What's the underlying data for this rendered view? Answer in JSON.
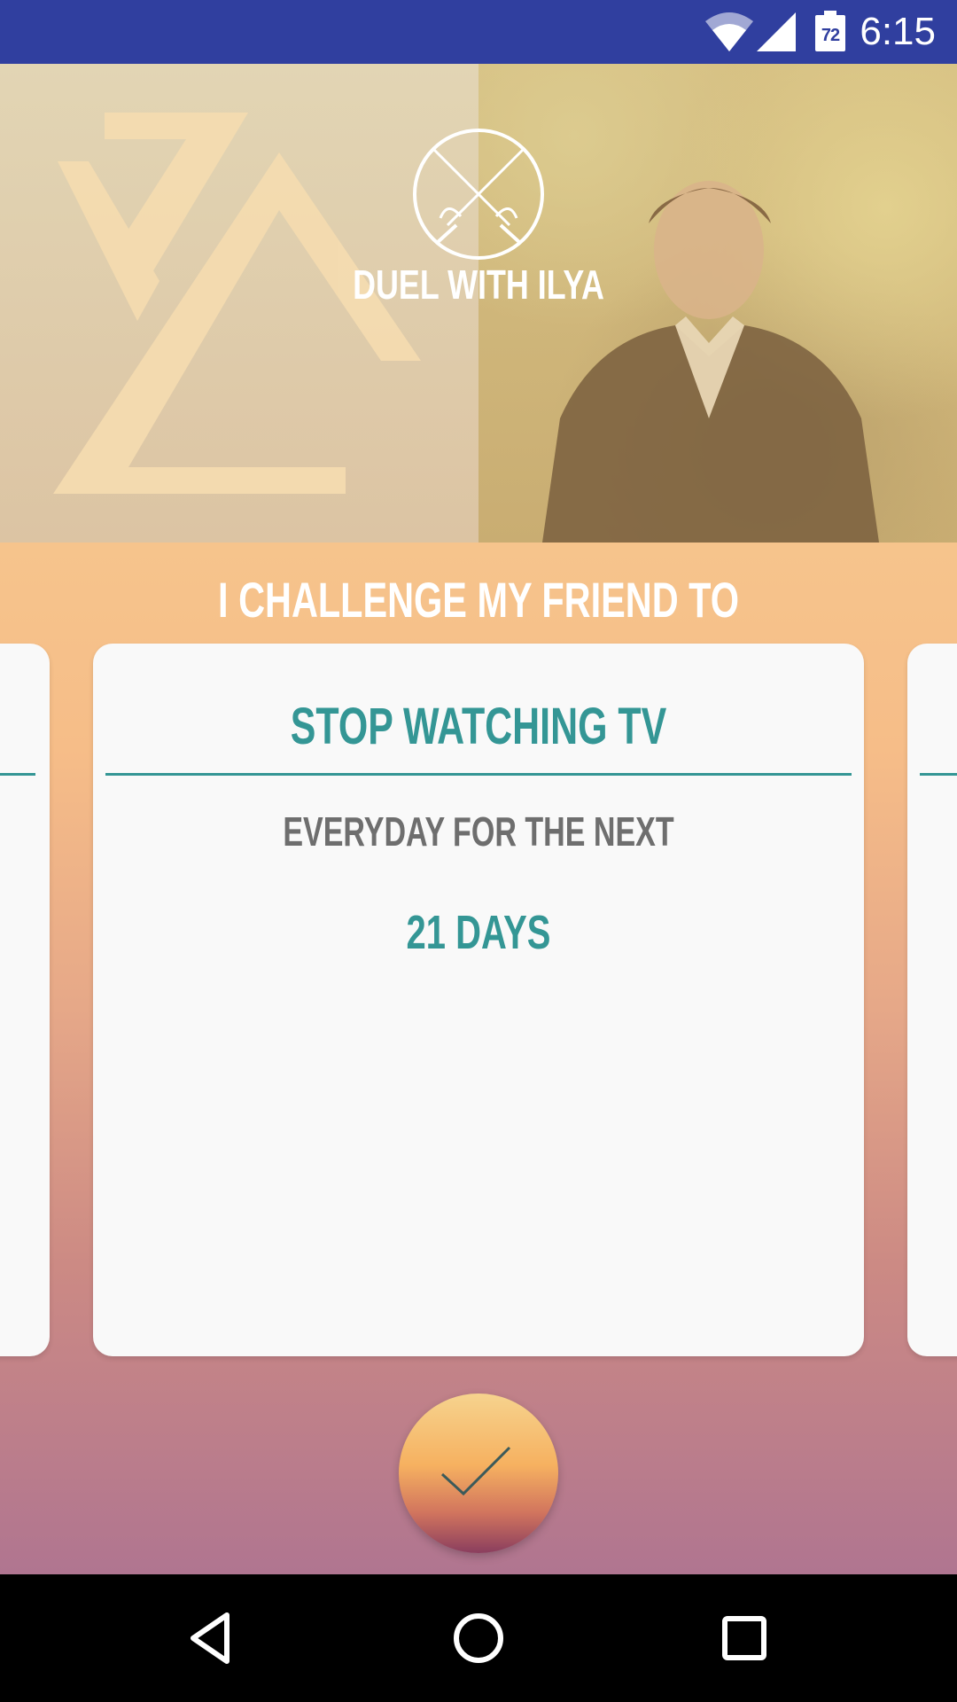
{
  "status_bar": {
    "time": "6:15",
    "battery_level": "72",
    "icons": [
      "wifi-icon",
      "cell-signal-icon",
      "battery-icon"
    ]
  },
  "header": {
    "title": "DUEL WITH ILYA",
    "emblem_icon": "crossed-swords-icon"
  },
  "main": {
    "heading": "I CHALLENGE MY FRIEND TO",
    "card": {
      "title": "STOP WATCHING TV",
      "subtitle": "EVERYDAY FOR THE NEXT",
      "duration": "21 DAYS"
    },
    "confirm_icon": "checkmark-icon"
  },
  "nav_bar": {
    "buttons": [
      "back-icon",
      "home-icon",
      "recents-icon"
    ]
  },
  "colors": {
    "status_bar": "#303f9f",
    "accent_teal": "#349695",
    "card_background": "#f9f9f9",
    "gradient_top": "#f6c48c",
    "gradient_bottom": "#b07590"
  }
}
